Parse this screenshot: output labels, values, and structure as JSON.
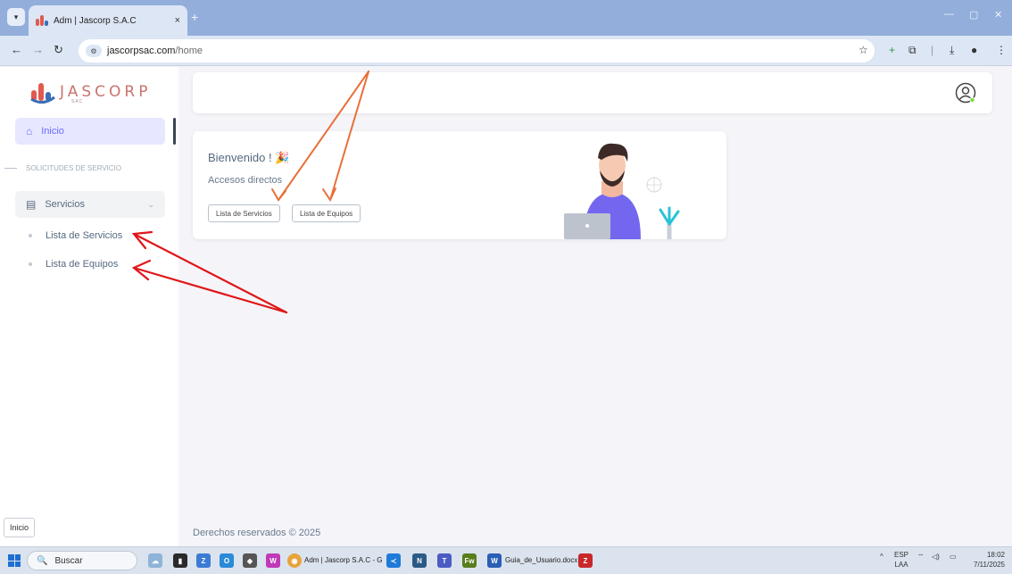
{
  "browser": {
    "tab_title": "Adm | Jascorp S.A.C",
    "tab_close": "×",
    "tab_new": "+",
    "url_domain": "jascorpsac.com",
    "url_path": "/home"
  },
  "sidebar": {
    "brand": "JASCORP",
    "brand_sub": "SAC",
    "active_item": "Inicio",
    "section_header": "SOLICITUDES DE SERVICIO",
    "group_label": "Servicios",
    "sub_items": [
      "Lista de Servicios",
      "Lista de Equipos"
    ]
  },
  "welcome": {
    "title": "Bienvenido ! 🎉",
    "subtitle": "Accesos directos",
    "buttons": [
      "Lista de Servicios",
      "Lista de Equipos"
    ]
  },
  "footer": "Derechos reservados © 2025",
  "status_tooltip": "Inicio",
  "taskbar": {
    "search_placeholder": "Buscar",
    "chrome_label": "Adm | Jascorp S.A.C - G",
    "word_label": "Guia_de_Usuario.docx -",
    "lang_top": "ESP",
    "lang_bottom": "LAA",
    "time": "18:02",
    "date": "7/11/2025"
  },
  "colors": {
    "accent": "#696cff",
    "active_bg": "#e7e7ff",
    "annotation_orange": "#e8703a",
    "annotation_red": "#e0161a",
    "brand_text": "#c9736d"
  }
}
